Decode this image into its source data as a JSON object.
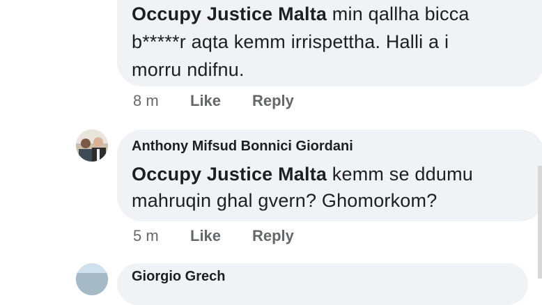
{
  "comments": [
    {
      "mention": "Occupy Justice Malta",
      "line1_rest": " min qallha bicca",
      "line2": "b*****r aqta kemm irrispettha. Halli a i",
      "line3": "morru ndifnu.",
      "time": "8 m",
      "like": "Like",
      "reply": "Reply"
    },
    {
      "author": "Anthony Mifsud Bonnici Giordani",
      "mention": "Occupy Justice Malta",
      "line1_rest": " kemm se ddumu",
      "line2": "mahruqin ghal gvern? Ghomorkom?",
      "time": "5 m",
      "like": "Like",
      "reply": "Reply"
    },
    {
      "author": "Giorgio Grech"
    }
  ]
}
